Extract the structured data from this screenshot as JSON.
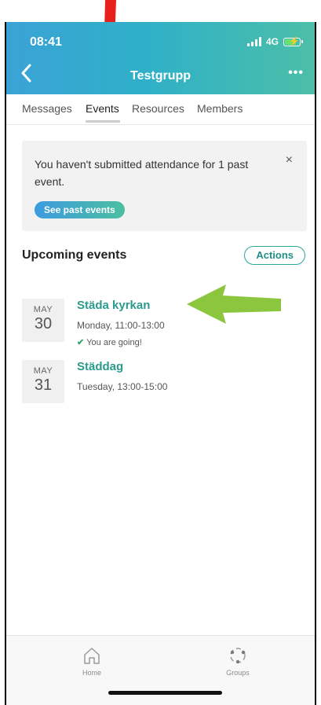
{
  "status_bar": {
    "time": "08:41",
    "network": "4G"
  },
  "header": {
    "title": "Testgrupp"
  },
  "tabs": [
    {
      "label": "Messages"
    },
    {
      "label": "Events"
    },
    {
      "label": "Resources"
    },
    {
      "label": "Members"
    }
  ],
  "banner": {
    "message": "You haven't submitted attendance for 1 past event.",
    "button_label": "See past events",
    "close_glyph": "×"
  },
  "upcoming": {
    "title": "Upcoming events",
    "actions_label": "Actions",
    "events": [
      {
        "month": "MAY",
        "day": "30",
        "title": "Städa kyrkan",
        "time": "Monday, 11:00-13:00",
        "status": "You are going!"
      },
      {
        "month": "MAY",
        "day": "31",
        "title": "Städdag",
        "time": "Tuesday, 13:00-15:00",
        "status": ""
      }
    ]
  },
  "bottom_nav": [
    {
      "label": "Home",
      "icon": "home-icon"
    },
    {
      "label": "Groups",
      "icon": "groups-icon"
    }
  ],
  "colors": {
    "accent_teal": "#2a9a8c",
    "header_blue": "#3aa3d6",
    "red_arrow": "#e8201c",
    "green_arrow": "#8cc63f"
  }
}
